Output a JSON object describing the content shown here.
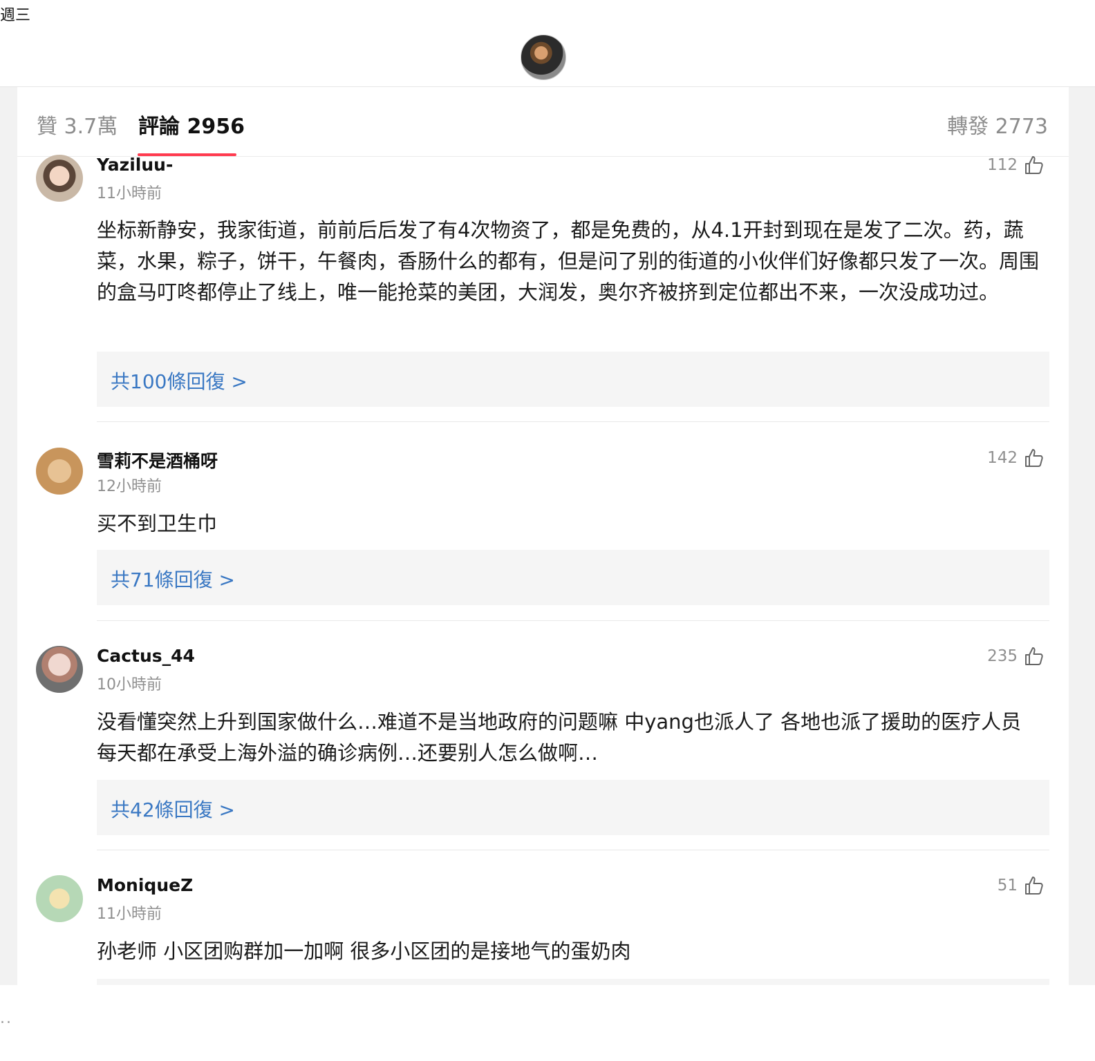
{
  "status": {
    "day": "週三"
  },
  "tabs": {
    "likes": "贊 3.7萬",
    "comments": "評論 2956",
    "reposts": "轉發 2773"
  },
  "comments": [
    {
      "username": "Yaziluu-",
      "time": "11小時前",
      "likes": "112",
      "text": "坐标新静安，我家街道，前前后后发了有4次物资了，都是免费的，从4.1开封到现在是发了二次。药，蔬菜，水果，粽子，饼干，午餐肉，香肠什么的都有，但是问了别的街道的小伙伴们好像都只发了一次。周围的盒马叮咚都停止了线上，唯一能抢菜的美团，大润发，奥尔齐被挤到定位都出不来，一次没成功过。",
      "replies": "共100條回復 >"
    },
    {
      "username": "雪莉不是酒桶呀",
      "time": "12小時前",
      "likes": "142",
      "text": "买不到卫生巾",
      "replies": "共71條回復 >"
    },
    {
      "username": "Cactus_44",
      "time": "10小時前",
      "likes": "235",
      "text": "没看懂突然上升到国家做什么…难道不是当地政府的问题嘛 中yang也派人了 各地也派了援助的医疗人员 每天都在承受上海外溢的确诊病例…还要别人怎么做啊…",
      "replies": "共42條回復 >"
    },
    {
      "username": "MoniqueZ",
      "time": "11小時前",
      "likes": "51",
      "text": "孙老师 小区团购群加一加啊 很多小区团的是接地气的蛋奶肉"
    }
  ],
  "footer": {
    "dots": ".."
  },
  "colors": {
    "accent": "#ff3b4f",
    "link": "#3a78c3"
  }
}
